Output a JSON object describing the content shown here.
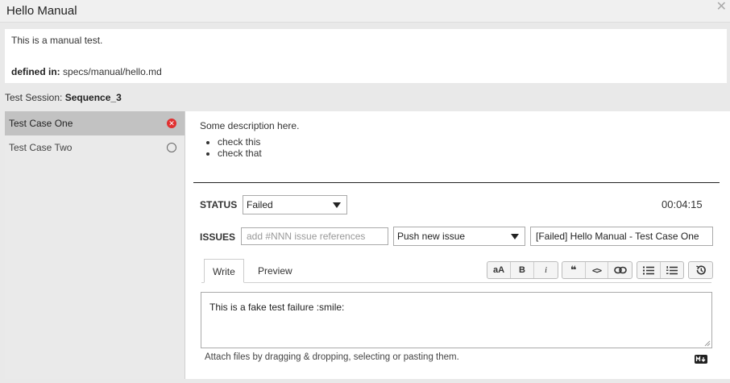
{
  "window": {
    "title": "Hello Manual",
    "close_label": "✕"
  },
  "description": {
    "text": "This is a manual test.",
    "defined_label": "defined in:",
    "defined_path": "specs/manual/hello.md"
  },
  "session": {
    "label": "Test Session:",
    "name": "Sequence_3"
  },
  "cases": [
    {
      "label": "Test Case One",
      "status": "failed",
      "active": true
    },
    {
      "label": "Test Case Two",
      "status": "pending",
      "active": false
    }
  ],
  "case_detail": {
    "intro": "Some description here.",
    "items": [
      "check this",
      "check that"
    ]
  },
  "status": {
    "label": "STATUS",
    "value": "Failed",
    "timer": "00:04:15"
  },
  "issues": {
    "label": "ISSUES",
    "placeholder": "add #NNN issue references",
    "push_option": "Push new issue",
    "issue_title": "[Failed] Hello Manual - Test Case One"
  },
  "editor": {
    "tabs": [
      "Write",
      "Preview"
    ],
    "active_tab": "Write",
    "toolbar": {
      "header": "aA",
      "bold": "B",
      "italic": "i",
      "quote": "❝",
      "code": "<>",
      "link": "link-icon",
      "ul": "list-icon",
      "ol": "ordered-list-icon",
      "history": "history-icon"
    },
    "content": "This is a fake test failure :smile:",
    "attach_hint": "Attach files by dragging & dropping, selecting or pasting them.",
    "markdown_icon": "markdown-icon"
  },
  "colors": {
    "failed": "#e03030",
    "active_case_bg": "#c2c2c2",
    "page_bg": "#e9e9e9"
  }
}
